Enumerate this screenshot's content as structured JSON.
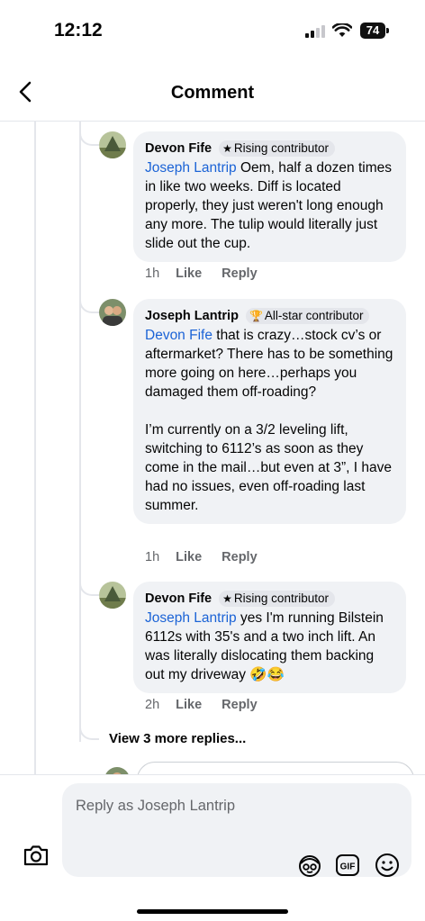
{
  "status_bar": {
    "time": "12:12",
    "battery": "74"
  },
  "nav": {
    "title": "Comment"
  },
  "comments": [
    {
      "author": "Devon Fife",
      "badge": "Rising contributor",
      "badge_icon": "star-icon",
      "mention": "Joseph Lantrip",
      "text": " Oem, half a dozen times in like two weeks. Diff is located properly, they just weren't long enough any more. The tulip would literally just slide out the cup.",
      "time": "1h",
      "like": "Like",
      "reply": "Reply"
    },
    {
      "author": "Joseph Lantrip",
      "badge": "All-star contributor",
      "badge_icon": "trophy-icon",
      "mention": "Devon Fife",
      "text": " that is crazy…stock cv’s or aftermarket? There has to be something more going on here…perhaps you damaged them off-roading?\n\nI’m currently on a 3/2 leveling lift, switching to 6112’s as soon as they come in the mail…but even at 3”, I have had no issues, even off-roading last summer.",
      "time": "1h",
      "like": "Like",
      "reply": "Reply"
    },
    {
      "author": "Devon Fife",
      "badge": "Rising contributor",
      "badge_icon": "star-icon",
      "mention": "Joseph Lantrip",
      "text": " yes I'm running Bilstein 6112s with 35's and a two inch lift. An was literally dislocating them backing out my driveway 🤣😂",
      "time": "2h",
      "like": "Like",
      "reply": "Reply"
    }
  ],
  "view_more": "View 3 more replies...",
  "composer": {
    "placeholder": "Reply as Joseph Lantrip",
    "gif_label": "GIF"
  },
  "colors": {
    "mention": "#1b63d6",
    "bubble": "#f0f2f5",
    "meta": "#65676b"
  }
}
